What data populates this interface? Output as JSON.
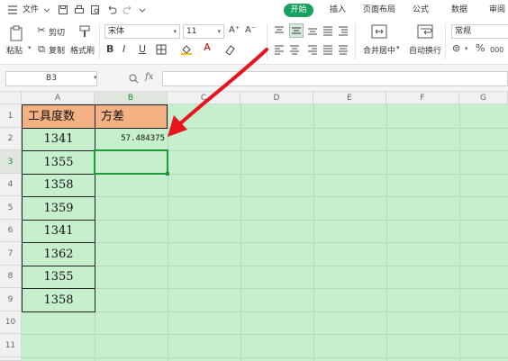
{
  "menubar": {
    "file_label": "文件",
    "tabs": [
      {
        "label": "开始",
        "active": true
      },
      {
        "label": "插入"
      },
      {
        "label": "页面布局"
      },
      {
        "label": "公式"
      },
      {
        "label": "数据"
      },
      {
        "label": "审阅"
      }
    ],
    "icons": [
      "menu-icon",
      "save-icon",
      "print-icon",
      "preview-icon",
      "undo-icon",
      "redo-icon",
      "dropdown-icon"
    ]
  },
  "ribbon": {
    "paste_label": "粘贴",
    "cut_label": "剪切",
    "copy_label": "复制",
    "format_painter_label": "格式刷",
    "font_name": "宋体",
    "font_size": "11",
    "bold": "B",
    "italic": "I",
    "underline": "U",
    "merge_center_label": "合并居中",
    "wrap_text_label": "自动换行",
    "number_format": "常规",
    "percent": "%",
    "thousands": "000"
  },
  "formula_bar": {
    "name_box": "B3",
    "fx_label": "fx",
    "value": ""
  },
  "sheet": {
    "columns": [
      "A",
      "B",
      "C",
      "D",
      "E",
      "F",
      "G"
    ],
    "selected_column": "B",
    "rows": [
      "1",
      "2",
      "3",
      "4",
      "5",
      "6",
      "7",
      "8",
      "9",
      "10",
      "11"
    ],
    "selected_row": "3",
    "a1": "工具度数",
    "b1": "方差",
    "b2": "57.484375",
    "col_a_values": [
      "1341",
      "1355",
      "1358",
      "1359",
      "1341",
      "1362",
      "1355",
      "1358"
    ]
  },
  "colors": {
    "accent": "#19a15f",
    "sheet_fill": "#c6efce",
    "header_fill": "#f4b183",
    "selection": "#1e9a3a",
    "arrow": "#e8141e"
  }
}
